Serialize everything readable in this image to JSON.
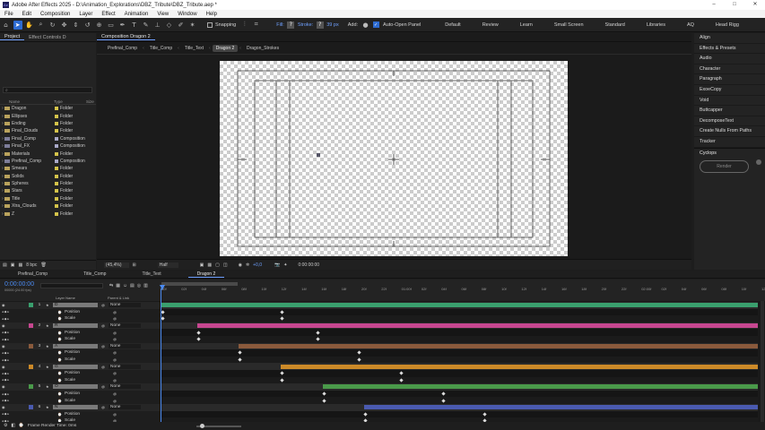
{
  "titlebar": {
    "app_title": "Adobe After Effects 2025 - D:\\Animation_Explorations\\DBZ_Tribute\\DBZ_Tribute.aep *",
    "minimize": "–",
    "maximize": "□",
    "close": "✕"
  },
  "menu": [
    "File",
    "Edit",
    "Composition",
    "Layer",
    "Effect",
    "Animation",
    "View",
    "Window",
    "Help"
  ],
  "toolbar": {
    "snapping": "Snapping",
    "fill": "Fill:",
    "stroke": "Stroke:",
    "stroke_width": "39 px",
    "add": "Add:",
    "auto_open": "Auto-Open Panel",
    "workspaces": [
      "Default",
      "Review",
      "Learn",
      "Small Screen",
      "Standard",
      "Libraries",
      "AQ",
      "Head Rigg"
    ]
  },
  "project": {
    "tab": "Project",
    "effect_tab": "Effect Controls D",
    "comp_tab_label": "Composition Dragon 2",
    "col_name": "Name",
    "col_type": "Type",
    "col_size": "Size",
    "items": [
      {
        "name": "Dragon",
        "type": "Folder",
        "color": "#d4c34a"
      },
      {
        "name": "Ellipses",
        "type": "Folder",
        "color": "#d4c34a"
      },
      {
        "name": "Ending",
        "type": "Folder",
        "color": "#d4c34a"
      },
      {
        "name": "Final_Clouds",
        "type": "Folder",
        "color": "#d4c34a"
      },
      {
        "name": "Final_Comp",
        "type": "Composition",
        "color": "#a9a9c9"
      },
      {
        "name": "Final_FX",
        "type": "Composition",
        "color": "#a9a9c9"
      },
      {
        "name": "Materials",
        "type": "Folder",
        "color": "#d4c34a"
      },
      {
        "name": "Prefinal_Comp",
        "type": "Composition",
        "color": "#a9a9c9"
      },
      {
        "name": "Smears",
        "type": "Folder",
        "color": "#d4c34a"
      },
      {
        "name": "Solids",
        "type": "Folder",
        "color": "#d4c34a"
      },
      {
        "name": "Spheres",
        "type": "Folder",
        "color": "#d4c34a"
      },
      {
        "name": "Stars",
        "type": "Folder",
        "color": "#d4c34a"
      },
      {
        "name": "Title",
        "type": "Folder",
        "color": "#d4c34a"
      },
      {
        "name": "Xtra_Clouds",
        "type": "Folder",
        "color": "#d4c34a"
      },
      {
        "name": "Z",
        "type": "Folder",
        "color": "#d4c34a"
      }
    ],
    "bpc": "8 bpc"
  },
  "viewer": {
    "breadcrumbs": [
      "Prefinal_Comp",
      "Title_Comp",
      "Title_Text",
      "Dragon 2",
      "Dragon_Strokes"
    ],
    "zoom": "(45,4%)",
    "resolution": "Half",
    "exposure": "+0,0",
    "timecode": "0:00:00:00"
  },
  "right_panel": {
    "items": [
      "Align",
      "Effects & Presets",
      "Audio",
      "Character",
      "Paragraph",
      "ExoeCopy",
      "Void",
      "Buttcapper",
      "DecomposeText",
      "Create Nulls From Paths",
      "Tracker"
    ],
    "cyclops": "Cyclops",
    "render": "Render"
  },
  "timeline": {
    "tabs": [
      "Prefinal_Comp",
      "Title_Comp",
      "Title_Text",
      "Dragon 2"
    ],
    "timecode": "0:00:00:00",
    "fps": "00000 (24.00 fps)",
    "col_layer": "Layer Name",
    "col_parent": "Parent & Link",
    "ruler": [
      "00f",
      "02f",
      "04f",
      "06f",
      "08f",
      "10f",
      "12f",
      "14f",
      "16f",
      "18f",
      "20f",
      "22f",
      "01:00f",
      "02f",
      "04f",
      "06f",
      "08f",
      "10f",
      "12f",
      "14f",
      "16f",
      "18f",
      "20f",
      "22f",
      "02:00f",
      "02f",
      "04f",
      "06f",
      "08f",
      "10f",
      "12f"
    ],
    "layers": [
      {
        "num": "1",
        "name": "D",
        "parent": "None",
        "color": "#3aa06e",
        "start": 0
      },
      {
        "num": "2",
        "name": "R",
        "parent": "None",
        "color": "#c74790",
        "start": 0.06
      },
      {
        "num": "3",
        "name": "A",
        "parent": "None",
        "color": "#8a5a3c",
        "start": 0.13
      },
      {
        "num": "4",
        "name": "G",
        "parent": "None",
        "color": "#cc8a28",
        "start": 0.2
      },
      {
        "num": "5",
        "name": "O",
        "parent": "None",
        "color": "#4a9a4a",
        "start": 0.27
      },
      {
        "num": "6",
        "name": "N",
        "parent": "None",
        "color": "#4a5ab0",
        "start": 0.34
      }
    ],
    "props": [
      "Position",
      "Scale"
    ],
    "footer": "Frame Render Time: 0ms"
  }
}
